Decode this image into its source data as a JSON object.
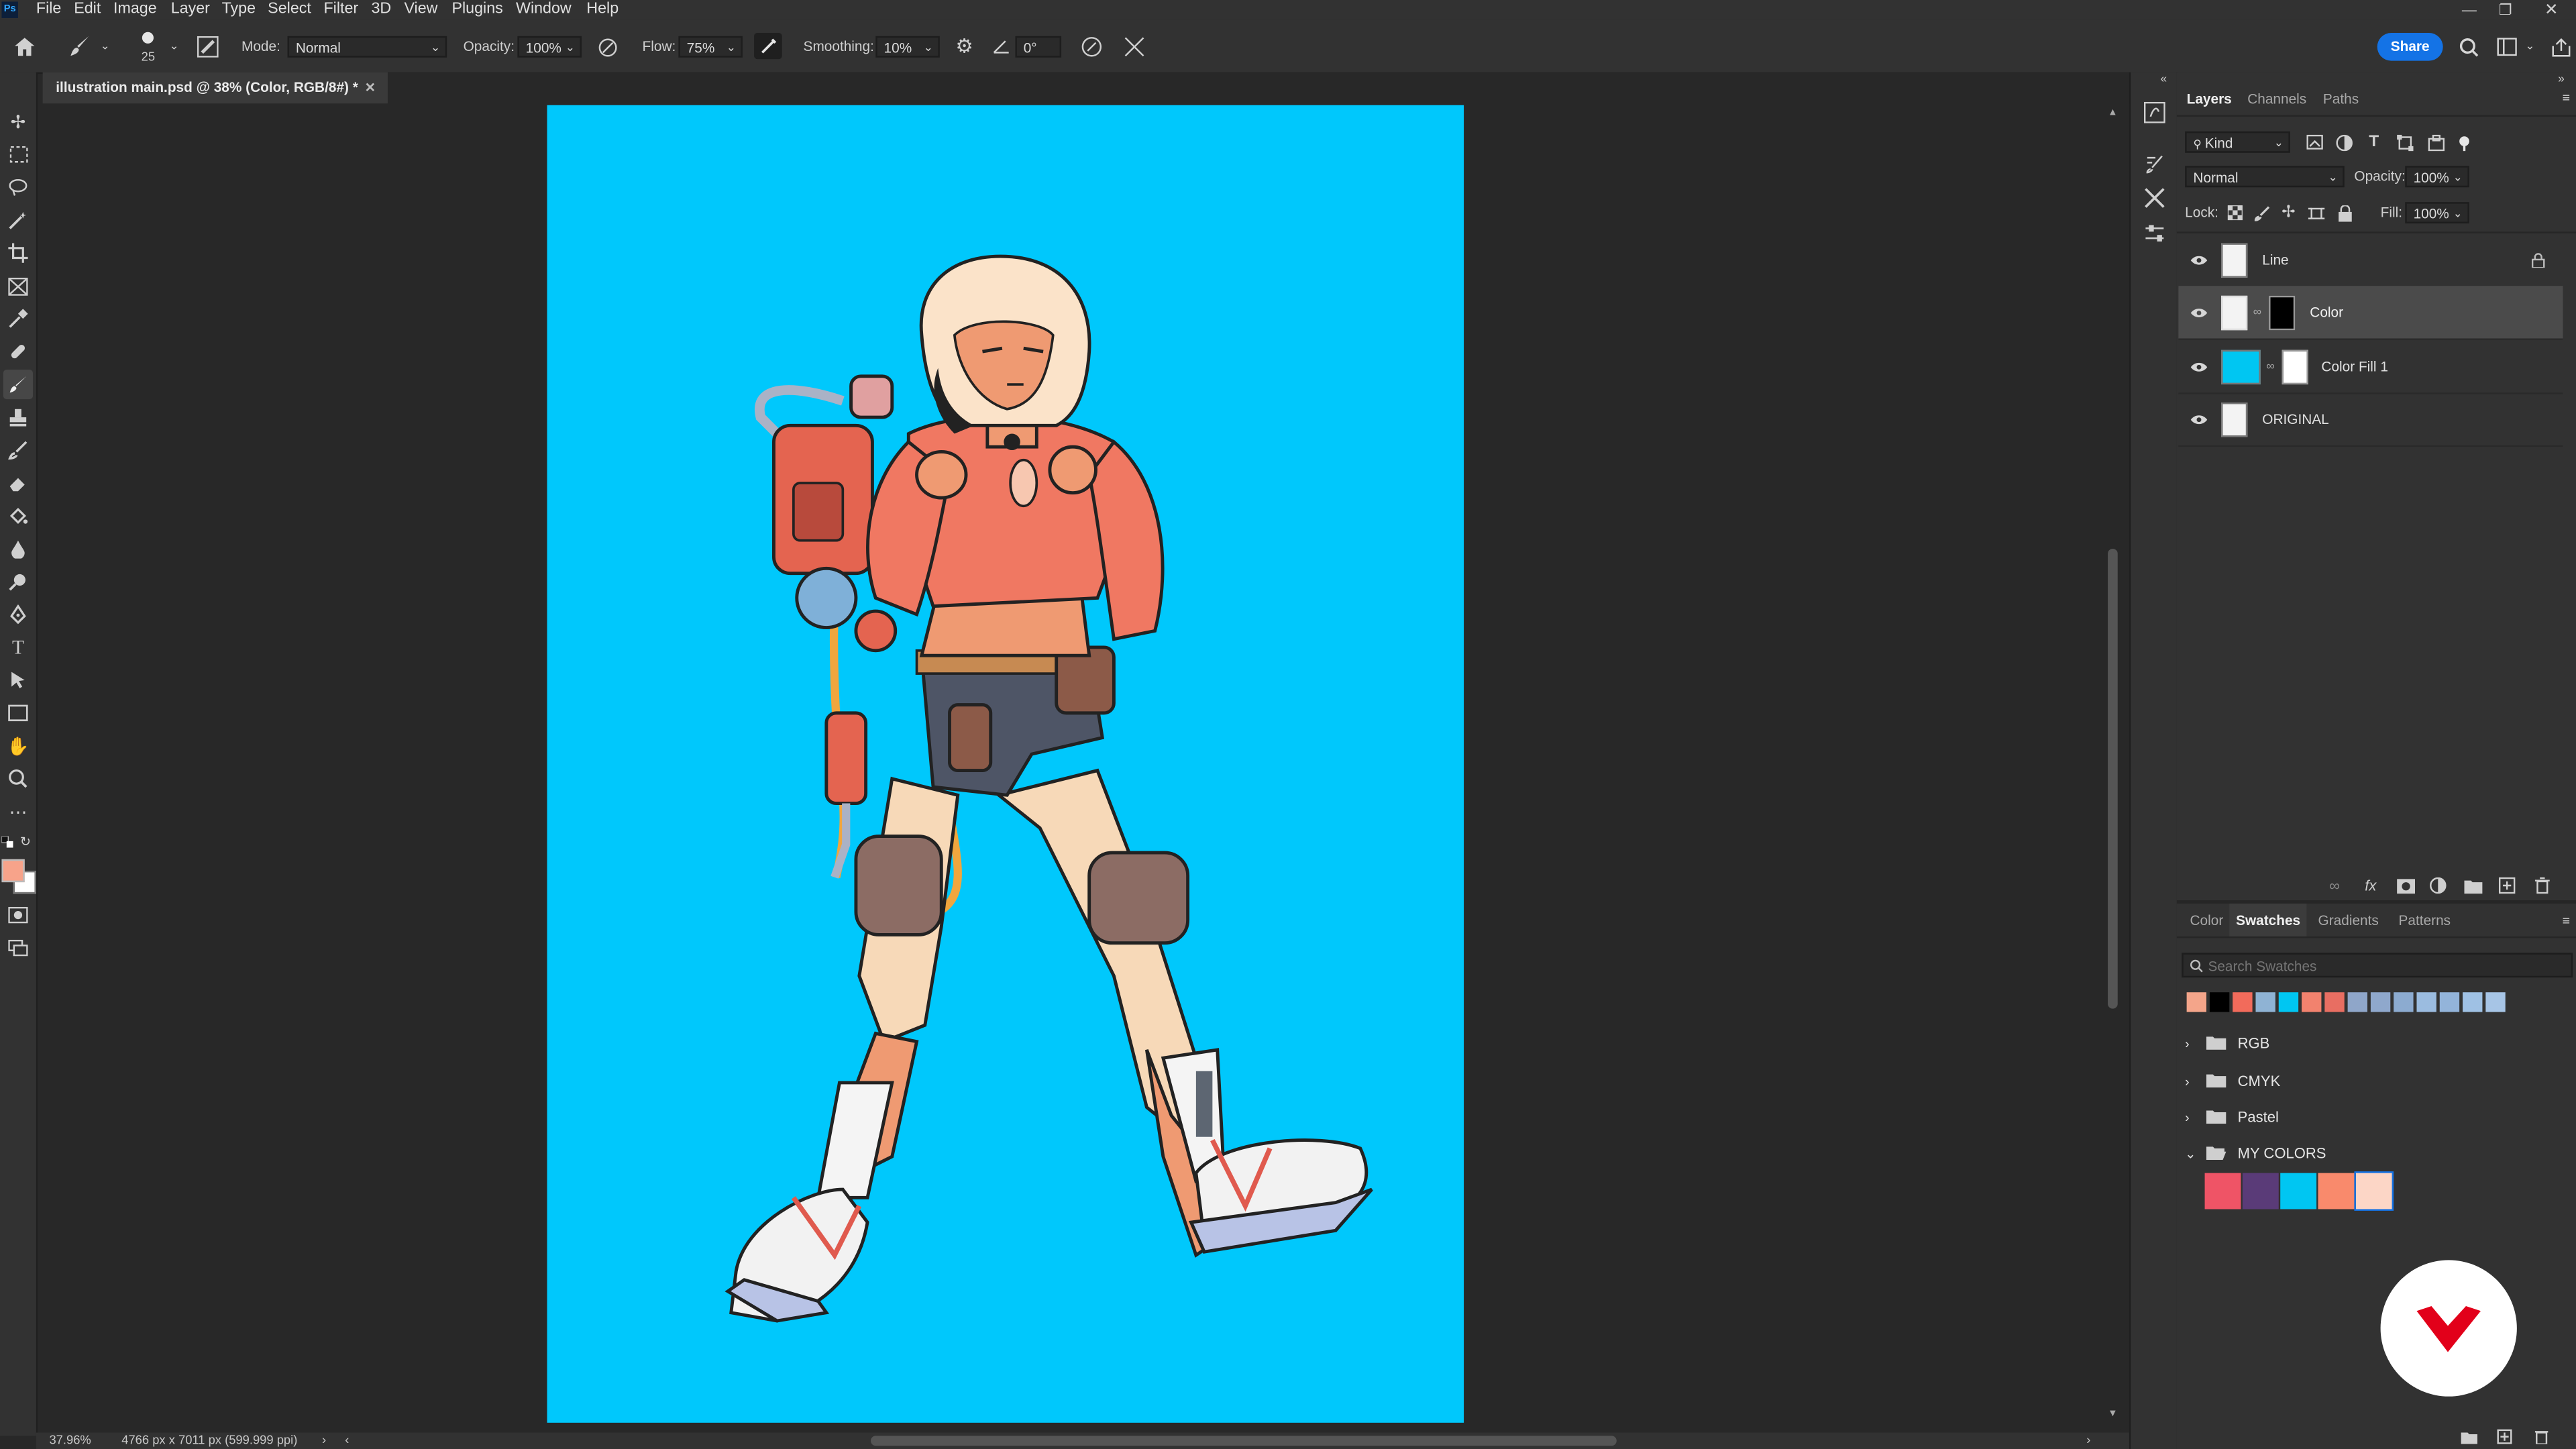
{
  "menu": [
    "File",
    "Edit",
    "Image",
    "Layer",
    "Type",
    "Select",
    "Filter",
    "3D",
    "View",
    "Plugins",
    "Window",
    "Help"
  ],
  "options": {
    "brush_size": "25",
    "mode_label": "Mode:",
    "mode_value": "Normal",
    "opacity_label": "Opacity:",
    "opacity_value": "100%",
    "flow_label": "Flow:",
    "flow_value": "75%",
    "smoothing_label": "Smoothing:",
    "smoothing_value": "10%",
    "angle_value": "0°",
    "share_label": "Share"
  },
  "document": {
    "tab_title": "illustration main.psd @ 38% (Color, RGB/8#) *"
  },
  "status": {
    "zoom": "37.96%",
    "dimensions": "4766 px x 7011 px (599.999 ppi)"
  },
  "layers_panel": {
    "tabs": [
      "Layers",
      "Channels",
      "Paths"
    ],
    "filter_value": "Kind",
    "blend_value": "Normal",
    "opacity_label": "Opacity:",
    "opacity_value": "100%",
    "lock_label": "Lock:",
    "fill_label": "Fill:",
    "fill_value": "100%",
    "layers": [
      {
        "name": "Line"
      },
      {
        "name": "Color"
      },
      {
        "name": "Color Fill 1"
      },
      {
        "name": "ORIGINAL"
      }
    ]
  },
  "swatches_panel": {
    "tabs": [
      "Color",
      "Swatches",
      "Gradients",
      "Patterns"
    ],
    "search_placeholder": "Search Swatches",
    "recent_colors": [
      "#f4a58a",
      "#000000",
      "#f26b5b",
      "#8fb3d4",
      "#00c6f2",
      "#f2826e",
      "#e86e62",
      "#8fa6c9",
      "#8fa8cc",
      "#8cabd0",
      "#9bbce0",
      "#93b4da",
      "#9fc1e4",
      "#a7c5e6"
    ],
    "folders": [
      {
        "name": "RGB",
        "open": false
      },
      {
        "name": "CMYK",
        "open": false
      },
      {
        "name": "Pastel",
        "open": false
      },
      {
        "name": "MY COLORS",
        "open": true
      }
    ],
    "my_colors": [
      "#ef5466",
      "#5a3b78",
      "#00c6f2",
      "#f98a6c",
      "#fcd6c6"
    ]
  },
  "colors": {
    "foreground": "#f7a38a",
    "background": "#ffffff",
    "canvas_bg": "#00c8fc",
    "accent": "#1473e6"
  }
}
